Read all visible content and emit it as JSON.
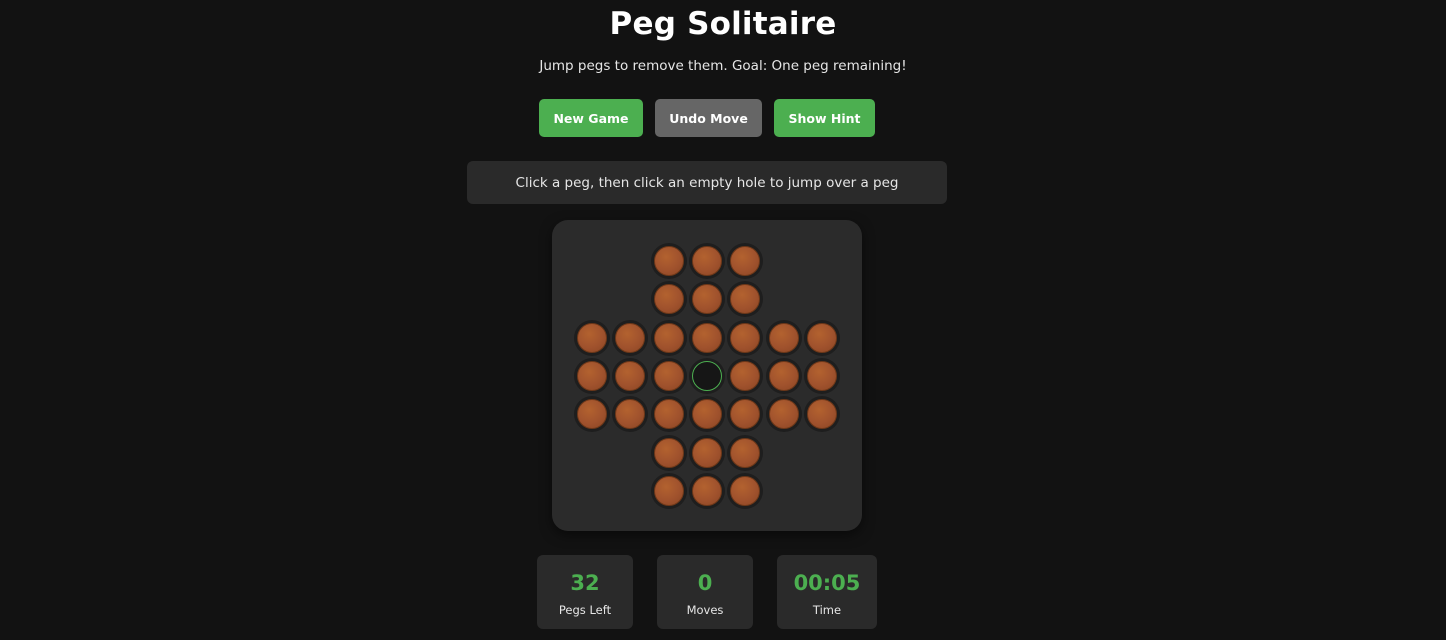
{
  "header": {
    "title": "Peg Solitaire",
    "subtitle": "Jump pegs to remove them. Goal: One peg remaining!"
  },
  "controls": {
    "new_game": "New Game",
    "undo_move": "Undo Move",
    "show_hint": "Show Hint"
  },
  "message": "Click a peg, then click an empty hole to jump over a peg",
  "board": {
    "layout": "english-cross-7x7",
    "cells": [
      [
        null,
        null,
        "peg",
        "peg",
        "peg",
        null,
        null
      ],
      [
        null,
        null,
        "peg",
        "peg",
        "peg",
        null,
        null
      ],
      [
        "peg",
        "peg",
        "peg",
        "peg",
        "peg",
        "peg",
        "peg"
      ],
      [
        "peg",
        "peg",
        "peg",
        "empty",
        "peg",
        "peg",
        "peg"
      ],
      [
        "peg",
        "peg",
        "peg",
        "peg",
        "peg",
        "peg",
        "peg"
      ],
      [
        null,
        null,
        "peg",
        "peg",
        "peg",
        null,
        null
      ],
      [
        null,
        null,
        "peg",
        "peg",
        "peg",
        null,
        null
      ]
    ],
    "colors": {
      "peg": "#a0522d",
      "empty_outline": "#4caf50"
    }
  },
  "stats": {
    "pegs_left": {
      "value": "32",
      "label": "Pegs Left"
    },
    "moves": {
      "value": "0",
      "label": "Moves"
    },
    "time": {
      "value": "00:05",
      "label": "Time"
    }
  },
  "colors": {
    "accent": "#4caf50",
    "background": "#121212",
    "panel": "#2a2a2a",
    "undo_button": "#666666"
  }
}
